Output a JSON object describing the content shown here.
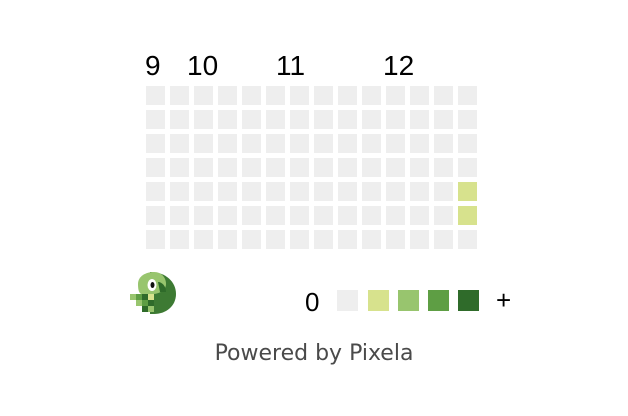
{
  "graph": {
    "month_labels": [
      "9",
      "10",
      "11",
      "12"
    ],
    "weeks": 14,
    "days_per_week": 7,
    "active_cells": [
      {
        "week": 13,
        "day": 4,
        "level": 1
      },
      {
        "week": 13,
        "day": 5,
        "level": 1
      }
    ]
  },
  "legend": {
    "min_label": "0",
    "max_label": "+",
    "colors": [
      "#eeeeee",
      "#d7e28d",
      "#98c56e",
      "#5e9e44",
      "#2f6b2a"
    ]
  },
  "footer": {
    "text": "Powered by Pixela"
  },
  "logo": {
    "icon": "pixela-logo-icon"
  }
}
